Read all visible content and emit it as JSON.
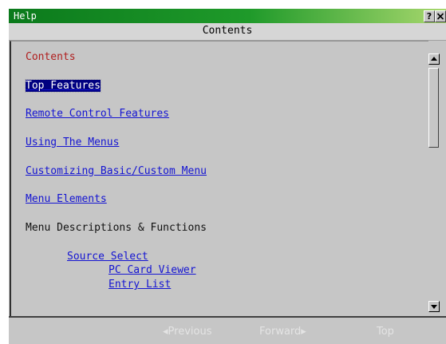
{
  "window": {
    "title": "Help",
    "help_button_label": "?",
    "close_button_icon": "close-icon"
  },
  "header": {
    "title": "Contents"
  },
  "content": {
    "heading": "Contents",
    "items": [
      {
        "label": "Top Features",
        "type": "link",
        "selected": true
      },
      {
        "label": "Remote Control Features",
        "type": "link"
      },
      {
        "label": "Using The Menus",
        "type": "link"
      },
      {
        "label": "Customizing Basic/Custom Menu",
        "type": "link"
      },
      {
        "label": "Menu Elements",
        "type": "link"
      },
      {
        "label": "Menu Descriptions & Functions",
        "type": "text"
      },
      {
        "label": "Source Select",
        "type": "link"
      },
      {
        "label": "PC Card Viewer",
        "type": "link"
      },
      {
        "label": "Entry List",
        "type": "link"
      }
    ]
  },
  "footer": {
    "previous": "◂Previous",
    "forward": "Forward▸",
    "top": "Top"
  },
  "colors": {
    "link": "#1414d2",
    "heading": "#b01e1e",
    "titlebar_start": "#0b7a1c",
    "titlebar_end": "#a9d86e",
    "selection": "#000080"
  }
}
